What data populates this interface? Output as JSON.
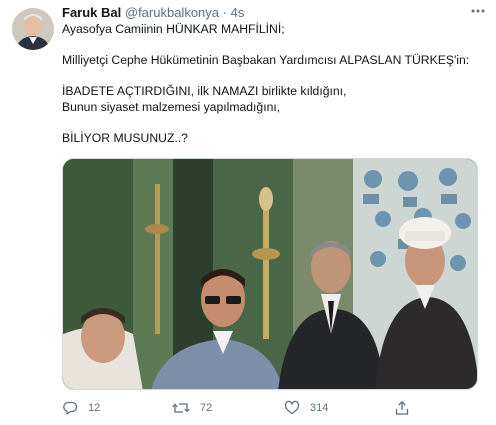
{
  "author": {
    "name": "Faruk Bal",
    "handle": "@farukbalkonya",
    "separator": "·",
    "time": "4s",
    "avatar_icon": "user-avatar-portrait"
  },
  "tweet": {
    "lines": [
      "Ayasofya Camiinin HÜNKAR MAHFİLİNİ;",
      "",
      "Milliyetçi Cephe Hükümetinin Başbakan Yardımcısı ALPASLAN TÜRKEŞ'in:",
      "",
      "İBADETE AÇTIRDIĞINI, ilk NAMAZI birlikte kıldığını,",
      "Bunun siyaset malzemesi yapılmadığını,",
      "",
      "BİLİYOR MUSUNUZ..?"
    ]
  },
  "media": {
    "kind": "photo",
    "icon": "historical-photo-men-in-mosque"
  },
  "actions": {
    "reply": {
      "icon": "reply-icon",
      "count": "12"
    },
    "retweet": {
      "icon": "retweet-icon",
      "count": "72"
    },
    "like": {
      "icon": "heart-icon",
      "count": "314"
    },
    "share": {
      "icon": "share-icon"
    }
  },
  "colors": {
    "text": "#0f1419",
    "muted": "#5b7083",
    "border": "#cfd9de"
  }
}
